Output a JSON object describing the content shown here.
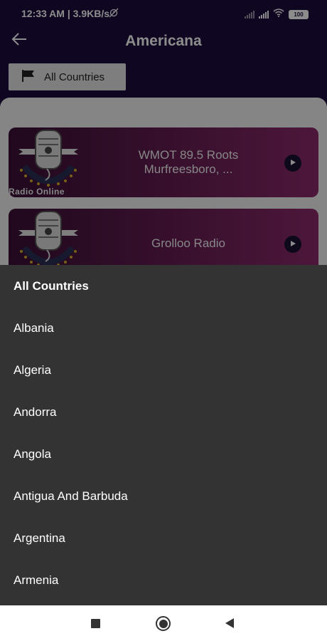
{
  "status_bar": {
    "time_speed": "12:33 AM | 3.9KB/s",
    "battery": "100",
    "icons": [
      "alarm-off-icon",
      "signal-icon",
      "signal-icon",
      "wifi-icon",
      "battery-icon"
    ]
  },
  "header": {
    "title": "Americana",
    "back_icon": "back-arrow-icon"
  },
  "filter": {
    "label": "All Countries",
    "icon": "flag-icon"
  },
  "stations": [
    {
      "name": "WMOT 89.5 Roots Murfreesboro, ...",
      "art_label": "Radio Online"
    },
    {
      "name": "Grolloo Radio"
    }
  ],
  "dropdown": {
    "options": [
      "All Countries",
      "Albania",
      "Algeria",
      "Andorra",
      "Angola",
      "Antigua And Barbuda",
      "Argentina",
      "Armenia"
    ],
    "selected": "All Countries"
  },
  "colors": {
    "app_bar": "#1d0d3c",
    "card_gradient_start": "#3a1037",
    "card_gradient_end": "#8c2a6b",
    "sheet": "#333333",
    "nav_bar": "#ffffff"
  },
  "nav": {
    "icons": [
      "recent-apps-icon",
      "home-icon",
      "back-icon"
    ]
  }
}
